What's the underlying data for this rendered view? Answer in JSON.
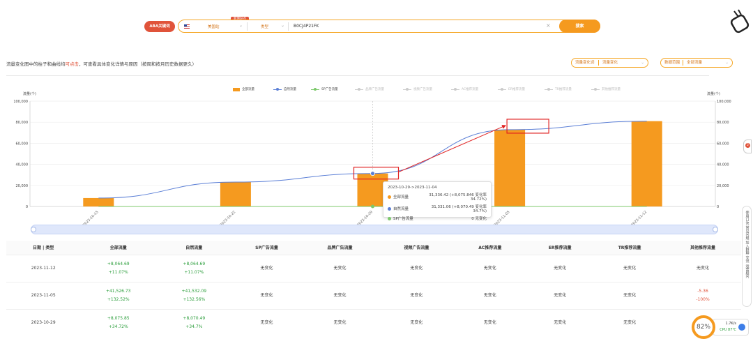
{
  "search": {
    "tool_button": "ABA关键词",
    "site_label": "美国站",
    "new_tag": "新增站点",
    "type_label": "类型",
    "asin_value": "B0CJ4P21FK",
    "clear_symbol": "×",
    "search_button": "搜索"
  },
  "info": {
    "prefix": "流量变化图中的柱子和曲线均",
    "link": "可点击",
    "suffix": "，可查看具体变化详情与原因（按周和按月历史数据更久）"
  },
  "selects": {
    "metric_label": "流量变化词",
    "metric_value": "流量变化",
    "scope_label": "数据范围",
    "scope_value": "全部流量"
  },
  "legend": [
    {
      "name": "全部流量",
      "active": true,
      "color": "#f59a1f",
      "kind": "bar"
    },
    {
      "name": "自然流量",
      "active": true,
      "color": "#5b7fd6",
      "kind": "line"
    },
    {
      "name": "SP广告流量",
      "active": true,
      "color": "#7cc96b",
      "kind": "line"
    },
    {
      "name": "品牌广告流量",
      "active": false,
      "color": "#ccc",
      "kind": "line"
    },
    {
      "name": "视频广告流量",
      "active": false,
      "color": "#ccc",
      "kind": "line"
    },
    {
      "name": "AC推荐流量",
      "active": false,
      "color": "#ccc",
      "kind": "line"
    },
    {
      "name": "ER推荐流量",
      "active": false,
      "color": "#ccc",
      "kind": "line"
    },
    {
      "name": "TR推荐流量",
      "active": false,
      "color": "#ccc",
      "kind": "line"
    },
    {
      "name": "其他推荐流量",
      "active": false,
      "color": "#ccc",
      "kind": "line"
    }
  ],
  "chart_data": {
    "type": "bar",
    "categories": [
      "2023-10-15",
      "2023-10-22",
      "2023-10-29",
      "2023-11-05",
      "2023-11-12"
    ],
    "series": [
      {
        "name": "全部流量",
        "type": "bar",
        "color": "#f59a1f",
        "values": [
          8000,
          23200,
          31336.42,
          72900,
          81000
        ]
      },
      {
        "name": "自然流量",
        "type": "line",
        "color": "#5b7fd6",
        "values": [
          8000,
          23200,
          31331.06,
          72900,
          81000
        ]
      },
      {
        "name": "SP广告流量",
        "type": "line",
        "color": "#7cc96b",
        "values": [
          0,
          0,
          0,
          0,
          0
        ]
      }
    ],
    "ylabel_left": "流量(个)",
    "ylabel_right": "流量(个)",
    "yticks_left": [
      "0",
      "20,000",
      "40,000",
      "60,000",
      "80,000",
      "100,000"
    ],
    "yticks_right": [
      "0",
      "20,000",
      "40,000",
      "60,000",
      "80,000",
      "100,000"
    ],
    "ylim": [
      0,
      100000
    ],
    "grid": true,
    "legend_position": "top-center"
  },
  "tooltip": {
    "title": "2023-10-29->2023-11-04",
    "rows": [
      {
        "name": "全部流量",
        "value": "31,336.42 (+8,075.846 变化率34.72%)",
        "color": "#f59a1f"
      },
      {
        "name": "自然流量",
        "value": "31,331.06 (+8,070.49 变化率34.7%)",
        "color": "#5b7fd6"
      },
      {
        "name": "SP广告流量",
        "value": "0 无变化",
        "color": "#7cc96b"
      }
    ]
  },
  "table": {
    "headers": [
      "日期 | 类型",
      "全部流量",
      "自然流量",
      "SP广告流量",
      "品牌广告流量",
      "视频广告流量",
      "AC推荐流量",
      "ER推荐流量",
      "TR推荐流量",
      "其他推荐流量"
    ],
    "rows": [
      {
        "date": "2023-11-12",
        "all": [
          "+8,064.69",
          "+11.07%"
        ],
        "natural": [
          "+8,064.69",
          "+11.07%"
        ],
        "sp": "无变化",
        "brand": "无变化",
        "video": "无变化",
        "ac": "无变化",
        "er": "无变化",
        "tr": "无变化",
        "other": [
          "无变化",
          ""
        ]
      },
      {
        "date": "2023-11-05",
        "all": [
          "+41,526.73",
          "+132.52%"
        ],
        "natural": [
          "+41,532.09",
          "+132.56%"
        ],
        "sp": "无变化",
        "brand": "无变化",
        "video": "无变化",
        "ac": "无变化",
        "er": "无变化",
        "tr": "无变化",
        "other": [
          "-5.36",
          "-100%"
        ]
      },
      {
        "date": "2023-10-29",
        "all": [
          "+8,075.85",
          "+34.72%"
        ],
        "natural": [
          "+8,070.49",
          "+34.7%"
        ],
        "sp": "无变化",
        "brand": "无变化",
        "video": "无变化",
        "ac": "无变化",
        "er": "无变化",
        "tr": "无变化",
        "other": [
          "",
          ""
        ]
      }
    ]
  },
  "side": {
    "badge": "2",
    "tool_text": "使用口诀 常见问题 加入群聊 交流 运营顾问"
  },
  "cpu": {
    "percent": "82%",
    "speed": "1.7K/s",
    "temp": "CPU 87℃"
  }
}
